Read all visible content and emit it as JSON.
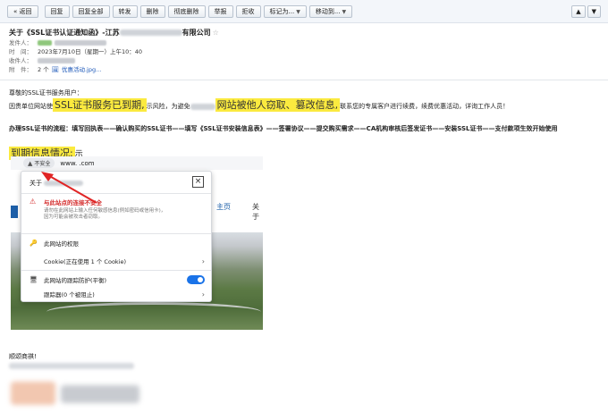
{
  "toolbar": {
    "back": "« 返回",
    "reply": "回复",
    "reply_all": "回复全部",
    "forward": "转发",
    "delete": "删除",
    "delete_permanent": "彻底删除",
    "report": "举报",
    "reject": "拒收",
    "mark_as": "标记为...",
    "move_to": "移动到...",
    "prev_icon": "up-icon",
    "next_icon": "down-icon"
  },
  "email": {
    "subject_prefix": "关于《SSL证书认证通知函》-江苏",
    "subject_suffix": "有限公司",
    "from_label": "发件人：",
    "time_label": "时　间：",
    "time_value": "2023年7月10日（星期一）上午10：40",
    "to_label": "收件人：",
    "attach_label": "附　件：",
    "attach_count": "2 个",
    "attach_name": "优惠活动.jpg..."
  },
  "content": {
    "greeting": "尊敬的SSL证书服务用户：",
    "para_start": "因贵单位网站使",
    "highlight_expired": "SSL证书服务已到期,",
    "para_mid": "示风险，为避免",
    "highlight_stolen": "网站被他人窃取、篡改信息,",
    "para_end": "联系您的专属客户进行续费，续费优惠活动，详询工作人员！",
    "process": "办理SSL证书的流程：填写回执表——确认购买的SSL证书——填写《SSL证书安装信息表》——签署协议——提交购买需求——CA机构审核后签发证书——安装SSL证书——支付款项生效开始使用",
    "highlight_info": "到期信息情况:",
    "info_suffix": "示",
    "closing": "顺颂商祺!"
  },
  "screenshot": {
    "insecure_label": "不安全",
    "address": "www.          .com",
    "popup_title": "关于",
    "warning_title": "与此站点的连接不安全",
    "warning_desc": "请勿在此网站上输入任何敏感信息(例如密码或信用卡)，因为可能会被攻击者窃取。",
    "permissions": "此网站的权限",
    "cookie": "Cookie(正在使用 1 个 Cookie)",
    "tracking": "此网站的跟踪防护(平衡)",
    "trackers": "跟踪器(0 个被阻止)",
    "menu_home": "主页",
    "menu_about": "关于"
  },
  "colors": {
    "highlight": "#fbea3f",
    "warning_red": "#d42b2b",
    "toggle_blue": "#1a73e8",
    "arrow_red": "#e02424"
  }
}
